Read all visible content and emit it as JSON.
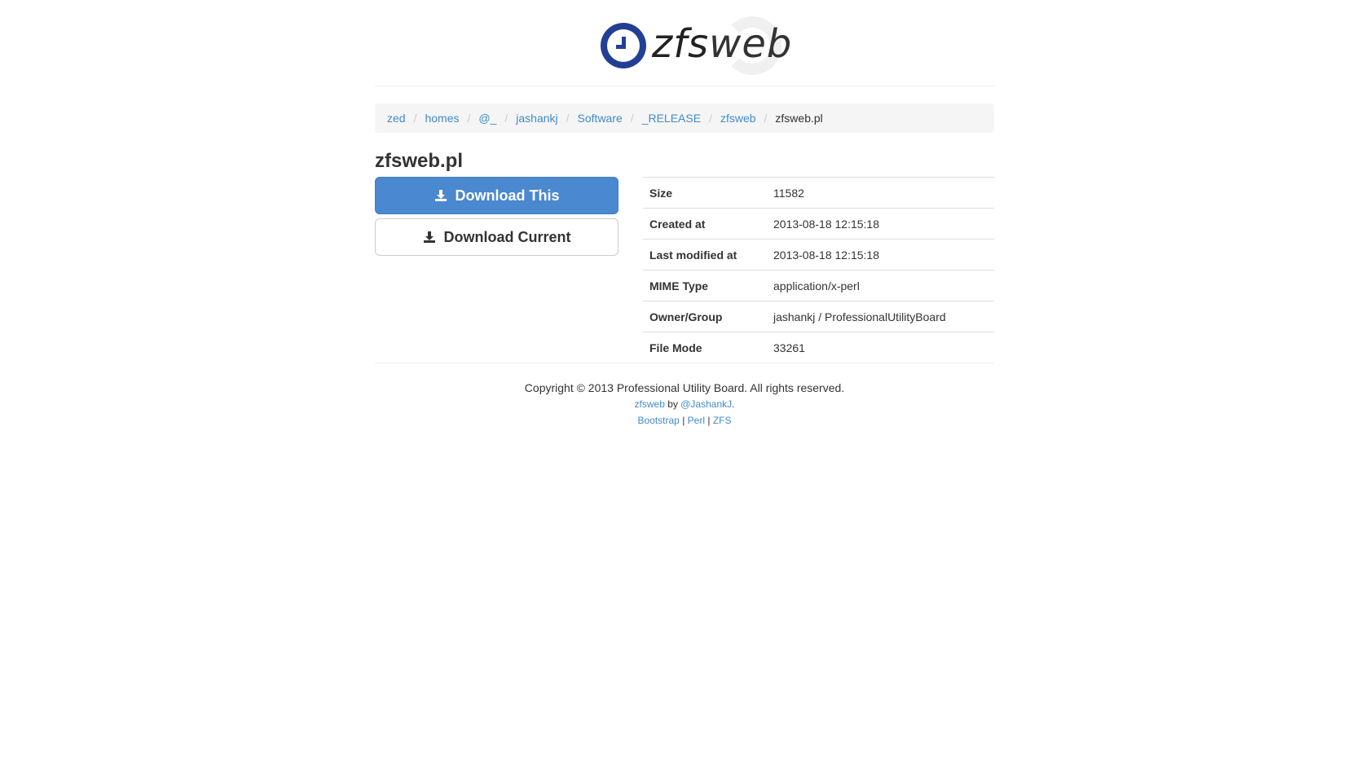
{
  "logo": {
    "text_a": "zfs",
    "text_b": "web"
  },
  "breadcrumb": {
    "items": [
      "zed",
      "homes",
      "@_",
      "jashankj",
      "Software",
      "_RELEASE",
      "zfsweb"
    ],
    "separator": "/",
    "active": "zfsweb.pl"
  },
  "file": {
    "title": "zfsweb.pl"
  },
  "buttons": {
    "download_this": "Download This",
    "download_current": "Download Current"
  },
  "meta": [
    {
      "key": "Size",
      "value": "11582"
    },
    {
      "key": "Created at",
      "value": "2013-08-18 12:15:18"
    },
    {
      "key": "Last modified at",
      "value": "2013-08-18 12:15:18"
    },
    {
      "key": "MIME Type",
      "value": "application/x-perl"
    },
    {
      "key": "Owner/Group",
      "value": "jashankj / ProfessionalUtilityBoard"
    },
    {
      "key": "File Mode",
      "value": "33261"
    }
  ],
  "footer": {
    "copyright": "Copyright © 2013 Professional Utility Board. All rights reserved.",
    "app_link": "zfsweb",
    "by_text": "by",
    "author_link": "@JashankJ",
    "period": ".",
    "links": [
      "Bootstrap",
      "Perl",
      "ZFS"
    ],
    "link_sep": "|"
  },
  "colors": {
    "primary": "#4a88d0",
    "link": "#428bca",
    "logo": "#233f95"
  },
  "icons": {
    "download": "download-icon"
  }
}
